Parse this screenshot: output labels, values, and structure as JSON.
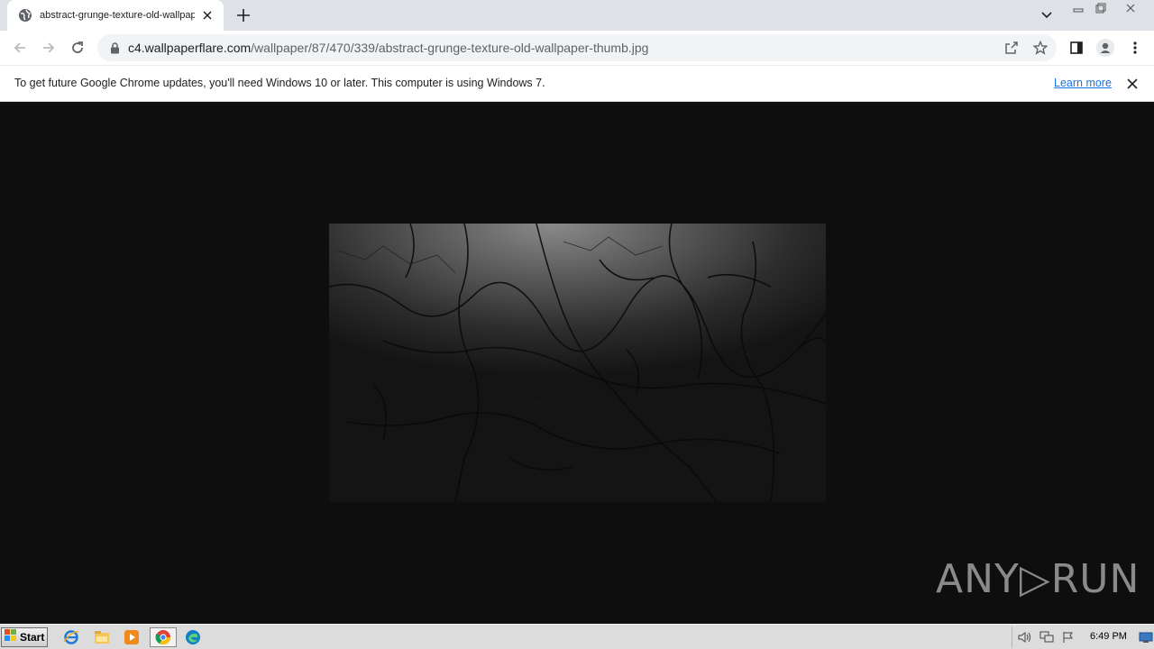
{
  "browser": {
    "tab": {
      "title": "abstract-grunge-texture-old-wallpap",
      "favicon": "globe-icon"
    },
    "url": {
      "host": "c4.wallpaperflare.com",
      "path": "/wallpaper/87/470/339/abstract-grunge-texture-old-wallpaper-thumb.jpg"
    },
    "infobar": {
      "message": "To get future Google Chrome updates, you'll need Windows 10 or later. This computer is using Windows 7.",
      "link": "Learn more"
    }
  },
  "content": {
    "image_description_icon": "cracked-texture-image",
    "watermark": "ANY▷RUN"
  },
  "taskbar": {
    "start_label": "Start",
    "apps": [
      "ie-icon",
      "explorer-icon",
      "media-player-icon",
      "chrome-icon",
      "edge-icon"
    ],
    "clock": "6:49 PM"
  },
  "colors": {
    "tabstrip": "#dee1e6",
    "content_bg": "#0e0e0e",
    "link": "#1a73e8",
    "taskbar": "#dcdcdc"
  }
}
